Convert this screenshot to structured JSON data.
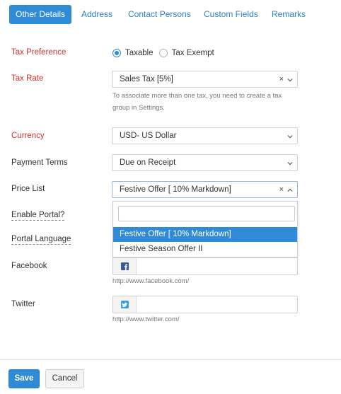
{
  "tabs": [
    {
      "label": "Other Details",
      "active": true
    },
    {
      "label": "Address",
      "active": false
    },
    {
      "label": "Contact Persons",
      "active": false
    },
    {
      "label": "Custom Fields",
      "active": false
    },
    {
      "label": "Remarks",
      "active": false
    }
  ],
  "tax_preference": {
    "label": "Tax Preference",
    "options": [
      "Taxable",
      "Tax Exempt"
    ],
    "selected": "Taxable"
  },
  "tax_rate": {
    "label": "Tax Rate",
    "value": "Sales Tax [5%]",
    "clear": "×",
    "helper_line1": "To associate more than one tax, you need to create a tax",
    "helper_line2": "group in Settings."
  },
  "currency": {
    "label": "Currency",
    "value": "USD- US Dollar"
  },
  "payment_terms": {
    "label": "Payment Terms",
    "value": "Due on Receipt"
  },
  "price_list": {
    "label": "Price List",
    "value": "Festive Offer [ 10% Markdown]",
    "clear": "×",
    "search_value": "",
    "options": [
      "Festive Offer [ 10% Markdown]",
      "Festive Season Offer II"
    ],
    "selected_index": 0
  },
  "enable_portal": {
    "label": "Enable Portal?"
  },
  "portal_language": {
    "label": "Portal Language"
  },
  "facebook": {
    "label": "Facebook",
    "value": "",
    "hint": "http://www.facebook.com/",
    "icon": "facebook-icon"
  },
  "twitter": {
    "label": "Twitter",
    "value": "",
    "hint": "http://www.twitter.com/",
    "icon": "twitter-icon"
  },
  "footer": {
    "save_label": "Save",
    "cancel_label": "Cancel"
  },
  "colors": {
    "accent": "#2f8bd6",
    "required": "#d2312f",
    "link": "#2a7ecb"
  }
}
